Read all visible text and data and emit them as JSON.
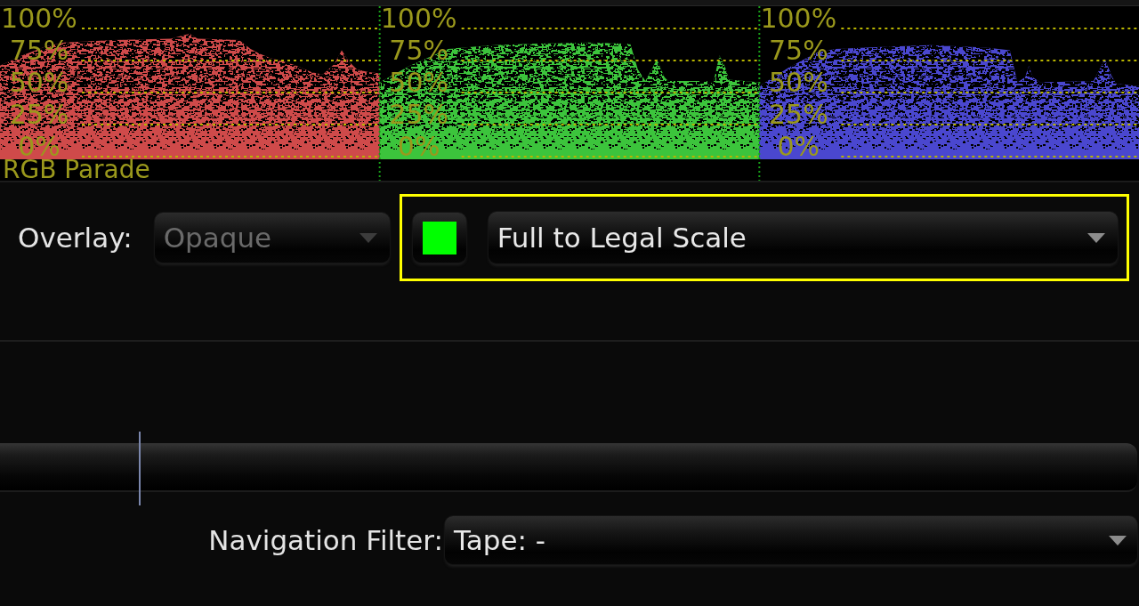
{
  "scope": {
    "title": "RGB Parade",
    "panels": [
      {
        "color": "#cf4a4a",
        "scale": [
          "100%",
          "75%",
          "50%",
          "25%",
          "0%"
        ]
      },
      {
        "color": "#3cc43c",
        "scale": [
          "100%",
          "75%",
          "50%",
          "25%",
          "0%"
        ]
      },
      {
        "color": "#4a47cf",
        "scale": [
          "100%",
          "75%",
          "50%",
          "25%",
          "0%"
        ]
      }
    ]
  },
  "overlay": {
    "label": "Overlay:",
    "mode": {
      "value": "Opaque",
      "disabled": true
    },
    "highlighted": true,
    "swatch": {
      "color": "#00ff00"
    },
    "scale": {
      "value": "Full to Legal Scale",
      "disabled": false
    }
  },
  "timeline": {
    "level": 0.122
  },
  "navigation_filter": {
    "label": "Navigation Filter:",
    "value": "Tape: -",
    "disabled": false
  }
}
